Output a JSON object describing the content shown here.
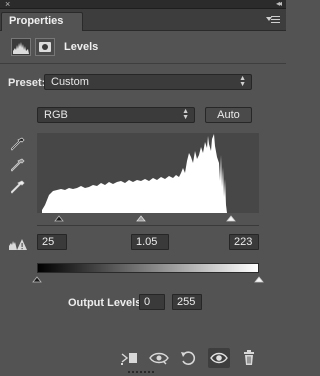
{
  "window": {
    "close_glyph": "×",
    "collapse_glyph": "◂◂",
    "menu_icon": "panel-menu-icon"
  },
  "panel": {
    "tab_label": "Properties",
    "adjustment_title": "Levels",
    "adjustment_icon": "levels-histogram-icon",
    "mask_icon": "layer-mask-icon"
  },
  "preset": {
    "label": "Preset:",
    "value": "Custom"
  },
  "channel": {
    "value": "RGB",
    "auto_label": "Auto"
  },
  "eyedroppers": [
    "black-point-eyedropper-icon",
    "gray-point-eyedropper-icon",
    "white-point-eyedropper-icon"
  ],
  "input_levels": {
    "black": "25",
    "gamma": "1.05",
    "white": "223"
  },
  "output_levels": {
    "label": "Output Levels:",
    "black": "0",
    "white": "255"
  },
  "histogram": {
    "color": "#ffffff",
    "background": "#474747"
  },
  "footer_icons": [
    "clip-to-layer-icon",
    "view-previous-state-icon",
    "reset-icon",
    "toggle-visibility-icon",
    "delete-icon"
  ]
}
